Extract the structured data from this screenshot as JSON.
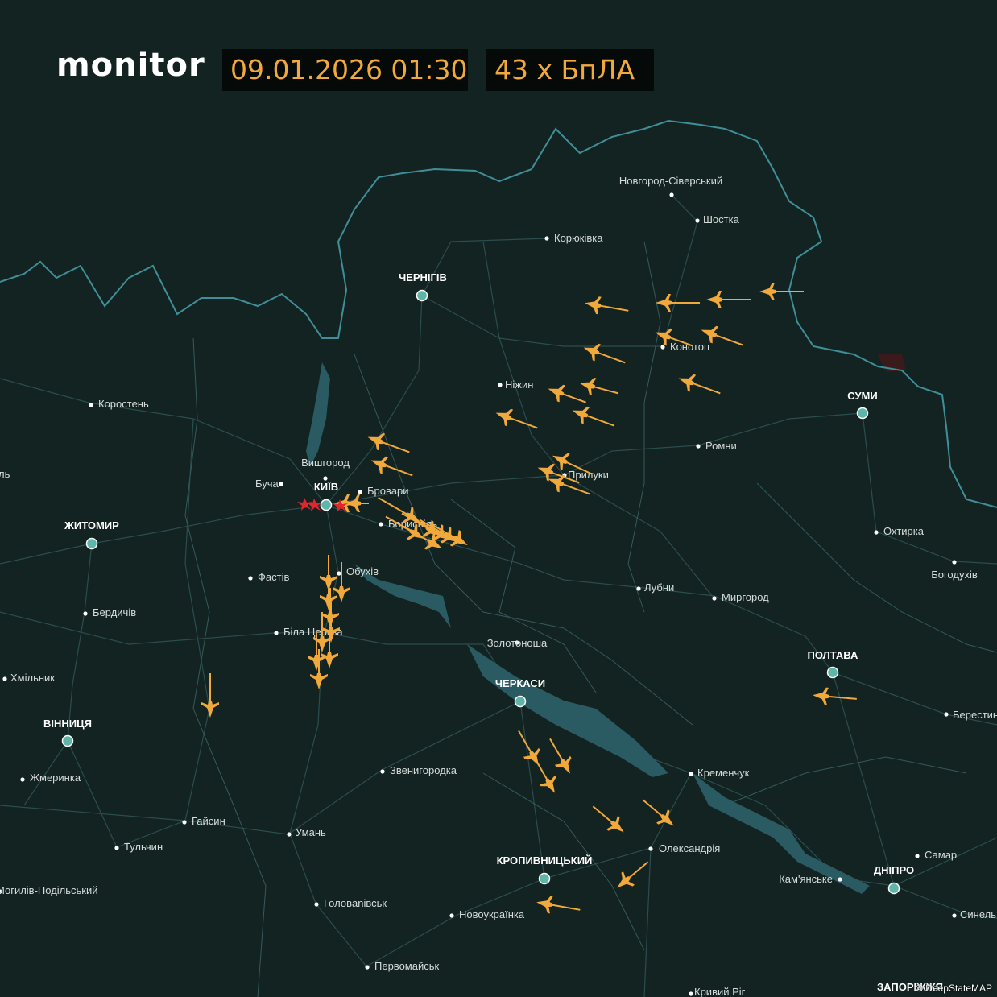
{
  "header": {
    "logo": "monitor",
    "datetime": "09.01.2026 01:30",
    "drone_count": "43 х БпЛА"
  },
  "colors": {
    "background": "#132321",
    "border": "#3f8f9a",
    "roads": "#2b4d4f",
    "water": "#2a5a62",
    "drone": "#f2a93b",
    "hit": "#e3262e",
    "major_city": "#5fb5a8"
  },
  "cities": {
    "major": [
      "ЧЕРНІГІВ",
      "КИЇВ",
      "ЖИТОМИР",
      "ВІННИЦЯ",
      "СУМИ",
      "ПОЛТАВА",
      "ЧЕРКАСИ",
      "КРОПИВНИЦЬКИЙ",
      "ДНІПРО"
    ],
    "minor": [
      "Новгород-Сіверський",
      "Шостка",
      "Корюківка",
      "Конотоп",
      "Ніжин",
      "Ромни",
      "Прилуки",
      "Коростень",
      "Вишгород",
      "Буча",
      "Бровари",
      "Бориспіль",
      "Обухів",
      "Фастів",
      "Бердичів",
      "Біла Церква",
      "Хмільник",
      "Жмеринка",
      "Охтирка",
      "Богодухів",
      "Лубни",
      "Миргород",
      "Золотоноша",
      "Кременчук",
      "Звенигородка",
      "Гайсин",
      "Умань",
      "Тульчин",
      "Могилів-Подільський",
      "Олександрія",
      "Кам'янське",
      "Самар",
      "Головanівськ",
      "Новоукраїнка",
      "Первомайськ",
      "Кривий Ріг",
      "Берестин",
      "Синель",
      "ЗАПОРІЖЖЯ"
    ],
    "cut_left": "ль"
  },
  "credit": "© DeepStateMAP",
  "icons": {
    "drone": "shahed-drone-icon",
    "hit": "explosion-icon",
    "city_marker": "city-dot-icon"
  }
}
